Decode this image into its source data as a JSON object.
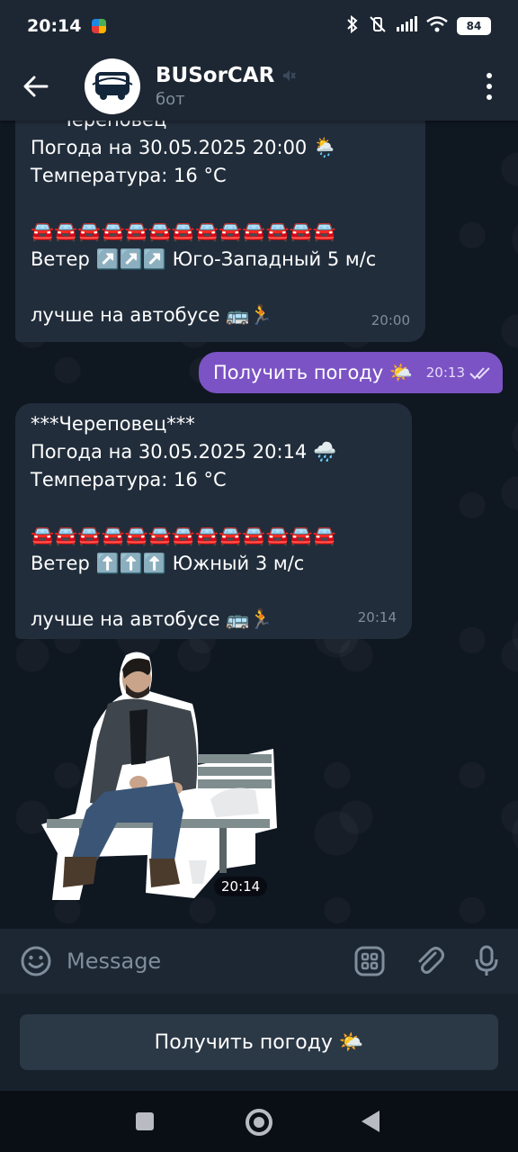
{
  "status_bar": {
    "time": "20:14",
    "battery": "84"
  },
  "header": {
    "chat_name": "BUSorCAR",
    "subtitle": "бот"
  },
  "messages": [
    {
      "lines": [
        "***Череповец***",
        "Погода на 30.05.2025 20:00 🌦️",
        "Температура: 16 °C",
        "",
        "🚘🚘🚘🚘🚘🚘🚘🚘🚘🚘🚘🚘🚘",
        "Ветер ↗️↗️↗️ Юго-Западный 5 м/с",
        "",
        "лучше на автобусе 🚌🏃"
      ],
      "time": "20:00"
    },
    {
      "lines": [
        "***Череповец***",
        "Погода на 30.05.2025 20:14 🌧️",
        "Температура: 16 °C",
        "",
        "🚘🚘🚘🚘🚘🚘🚘🚘🚘🚘🚘🚘🚘",
        "Ветер ⬆️⬆️⬆️ Южный 3 м/с",
        "",
        "лучше на автобусе 🚌🏃"
      ],
      "time": "20:14"
    }
  ],
  "outgoing": {
    "text": "Получить погоду 🌤️",
    "time": "20:13"
  },
  "sticker": {
    "time": "20:14"
  },
  "input": {
    "placeholder": "Message"
  },
  "reply_keyboard": {
    "button_label": "Получить погоду 🌤️"
  }
}
